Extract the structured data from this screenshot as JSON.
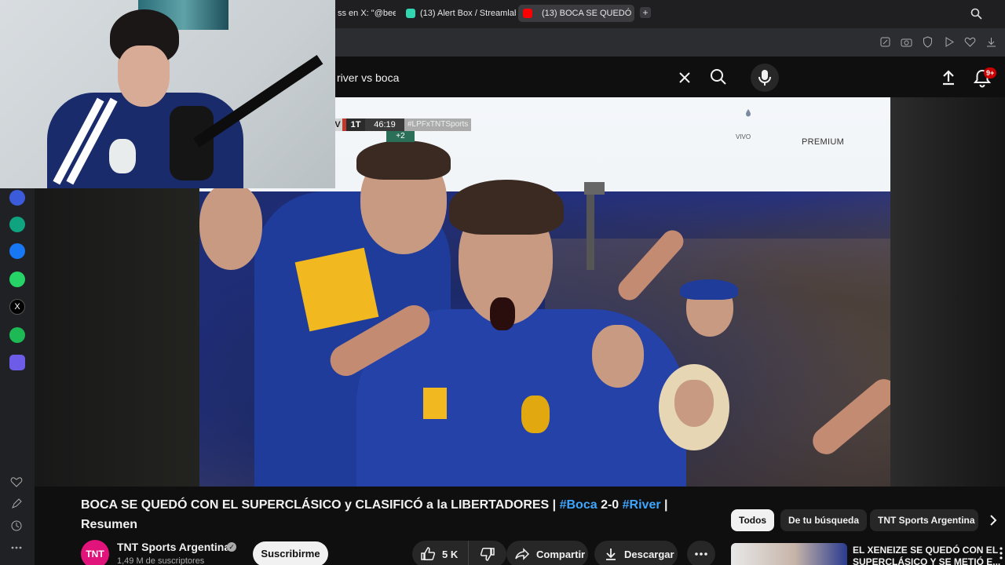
{
  "browser": {
    "tabs": [
      {
        "label": "ss en X: \"@bee",
        "favicon": "x-icon",
        "color": "#000000"
      },
      {
        "label": "(13) Alert Box / Streamlab",
        "favicon": "streamlabs-icon",
        "color": "#2fd6b0"
      },
      {
        "label": "(13) BOCA SE QUEDÓ",
        "favicon": "youtube-icon",
        "color": "#ff0000",
        "active": true
      }
    ]
  },
  "youtube": {
    "search_query": "river vs boca",
    "notification_count": "9+"
  },
  "video": {
    "scorebug": {
      "team": "V",
      "half": "1T",
      "clock": "46:19",
      "hashtag": "#LPFxTNTSports",
      "added_time": "+2"
    },
    "live_label": "VIVO",
    "premium_label": "PREMIUM"
  },
  "watch": {
    "title_plain": "BOCA SE QUEDÓ CON EL SUPERCLÁSICO y CLASIFICÓ a la LIBERTADORES | ",
    "title_hash1": "#Boca",
    "title_mid": " 2-0 ",
    "title_hash2": "#River",
    "title_end": " | Resumen",
    "channel": {
      "logo_text": "TNT",
      "name": "TNT Sports Argentina",
      "subscribers": "1,49 M de suscriptores",
      "subscribe_label": "Suscribirme"
    },
    "actions": {
      "likes": "5 K",
      "share": "Compartir",
      "download": "Descargar"
    }
  },
  "chips": [
    {
      "label": "Todos",
      "selected": true
    },
    {
      "label": "De tu búsqueda",
      "selected": false
    },
    {
      "label": "TNT Sports Argentina",
      "selected": false
    }
  ],
  "recommendation": {
    "title": "EL XENEIZE SE QUEDÓ CON EL SUPERCLÁSICO Y SE METIÓ E..."
  }
}
